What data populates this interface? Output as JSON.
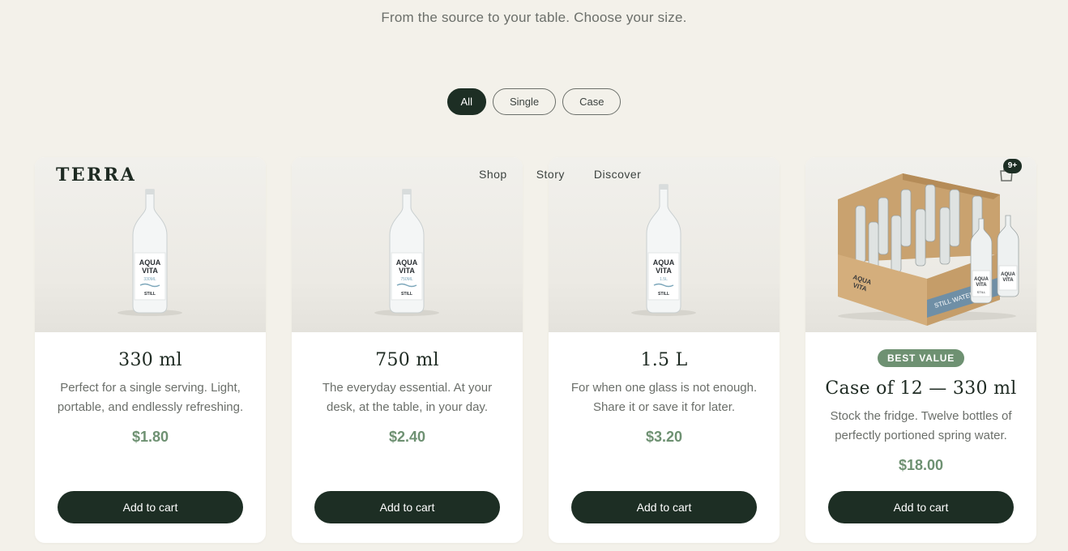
{
  "header": {
    "subtitle": "From the source to your table. Choose your size.",
    "logo": "TERRA",
    "nav": [
      "Shop",
      "Story",
      "Discover"
    ],
    "cart_count": "9+"
  },
  "filters": [
    {
      "label": "All",
      "active": true
    },
    {
      "label": "Single",
      "active": false
    },
    {
      "label": "Case",
      "active": false
    }
  ],
  "products": [
    {
      "title": "330 ml",
      "description": "Perfect for a single serving. Light, portable, and endlessly refreshing.",
      "price": "$1.80",
      "button": "Add to cart",
      "label_brand": [
        "AQUA",
        "VITA"
      ],
      "label_size": "330ML",
      "label_type": "STILL"
    },
    {
      "title": "750 ml",
      "description": "The everyday essential. At your desk, at the table, in your day.",
      "price": "$2.40",
      "button": "Add to cart",
      "label_brand": [
        "AQUA",
        "VITA"
      ],
      "label_size": "750ML",
      "label_type": "STILL"
    },
    {
      "title": "1.5 L",
      "description": "For when one glass is not enough. Share it or save it for later.",
      "price": "$3.20",
      "button": "Add to cart",
      "label_brand": [
        "AQUA",
        "VITA"
      ],
      "label_size": "1.5L",
      "label_type": "STILL"
    },
    {
      "badge": "BEST VALUE",
      "title": "Case of 12 — 330 ml",
      "description": "Stock the fridge. Twelve bottles of perfectly portioned spring water.",
      "price": "$18.00",
      "button": "Add to cart",
      "label_brand": [
        "AQUA",
        "VITA"
      ],
      "label_type": "STILL",
      "box_text": "STILL WATER"
    }
  ],
  "colors": {
    "background": "#f3f1ea",
    "primary": "#1d2e24",
    "accent": "#6e9172",
    "muted_text": "#6b6f6a"
  }
}
